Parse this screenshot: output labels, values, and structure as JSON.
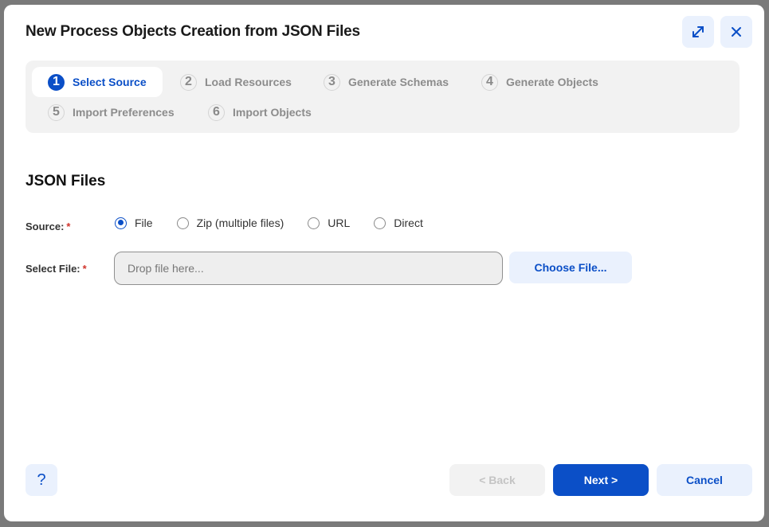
{
  "dialog": {
    "title": "New Process Objects Creation from JSON Files",
    "expand_icon": "expand-arrows-icon",
    "close_icon": "close-icon"
  },
  "stepper": {
    "active_step": 1,
    "steps": [
      {
        "number": "1",
        "label": "Select Source"
      },
      {
        "number": "2",
        "label": "Load Resources"
      },
      {
        "number": "3",
        "label": "Generate Schemas"
      },
      {
        "number": "4",
        "label": "Generate Objects"
      },
      {
        "number": "5",
        "label": "Import Preferences"
      },
      {
        "number": "6",
        "label": "Import Objects"
      }
    ]
  },
  "form": {
    "section_title": "JSON Files",
    "source": {
      "label": "Source:",
      "required_mark": "*",
      "selected": "File",
      "options": [
        "File",
        "Zip (multiple files)",
        "URL",
        "Direct"
      ]
    },
    "select_file": {
      "label": "Select File:",
      "required_mark": "*",
      "value": "",
      "placeholder": "Drop file here...",
      "choose_button": "Choose File..."
    }
  },
  "footer": {
    "help_label": "?",
    "back_label": "< Back",
    "back_enabled": false,
    "next_label": "Next >",
    "cancel_label": "Cancel"
  },
  "colors": {
    "accent": "#0b4fc7",
    "button_light": "#eaf1fd",
    "stepper_bg": "#f2f2f2",
    "required": "#d0342c"
  }
}
